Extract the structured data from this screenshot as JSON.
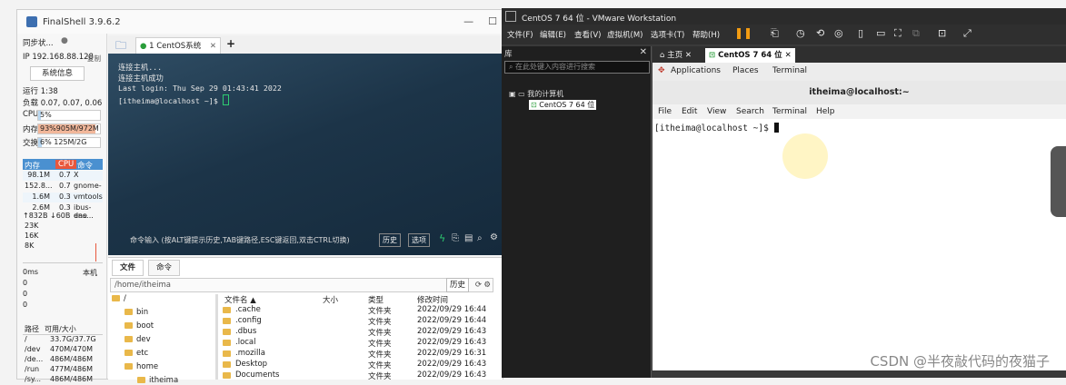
{
  "finalshell": {
    "title": "FinalShell 3.9.6.2",
    "sync_status": "同步状...",
    "ip": "IP 192.168.88.128",
    "copy_label": "复制",
    "sysinfo_btn": "系统信息",
    "uptime": "运行 1:38",
    "load": "负载 0.07, 0.07, 0.06",
    "cpu_label": "CPU",
    "cpu_value": "5%",
    "cpu_fraction": 0.05,
    "mem_label": "内存",
    "mem_value": "93%905M/972M",
    "mem_fraction": 0.93,
    "swap_label": "交换",
    "swap_value": "6%     125M/2G",
    "swap_fraction": 0.06,
    "proc_headers": [
      "内存",
      "CPU",
      "命令"
    ],
    "procs": [
      {
        "mem": "98.1M",
        "cpu": "0.7",
        "cmd": "X"
      },
      {
        "mem": "152.8...",
        "cpu": "0.7",
        "cmd": "gnome-"
      },
      {
        "mem": "1.6M",
        "cpu": "0.3",
        "cmd": "vmtools"
      },
      {
        "mem": "2.6M",
        "cpu": "0.3",
        "cmd": "ibus-dae"
      }
    ],
    "net_up": "↑832B",
    "net_down": "↓60B",
    "net_iface": "ens...",
    "net_ticks": [
      "23K",
      "16K",
      "8K"
    ],
    "ping_label": "0ms",
    "ping_host": "本机",
    "ping_ticks": [
      "0",
      "0",
      "0"
    ],
    "disk_headers": [
      "路径",
      "可用/大小"
    ],
    "disks": [
      {
        "path": "/",
        "size": "33.7G/37.7G"
      },
      {
        "path": "/dev",
        "size": "470M/470M"
      },
      {
        "path": "/de...",
        "size": "486M/486M"
      },
      {
        "path": "/run",
        "size": "477M/486M"
      },
      {
        "path": "/sy...",
        "size": "486M/486M"
      }
    ],
    "tab_label": "1 CentOS系统",
    "terminal_lines": [
      "连接主机...",
      "连接主机成功",
      "Last login: Thu Sep 29 01:43:41 2022",
      "[itheima@localhost ~]$ "
    ],
    "cmd_placeholder": "命令输入 (按ALT键提示历史,TAB键路径,ESC键返回,双击CTRL切换)",
    "history_btn": "历史",
    "options_btn": "选项",
    "lower_tabs": [
      "文件",
      "命令"
    ],
    "path": "/home/itheima",
    "path_history": "历史",
    "tree": [
      {
        "name": "/",
        "indent": 0
      },
      {
        "name": "bin",
        "indent": 1
      },
      {
        "name": "boot",
        "indent": 1
      },
      {
        "name": "dev",
        "indent": 1
      },
      {
        "name": "etc",
        "indent": 1
      },
      {
        "name": "home",
        "indent": 1
      },
      {
        "name": "itheima",
        "indent": 2
      }
    ],
    "file_headers": [
      "文件名 ▲",
      "大小",
      "类型",
      "修改时间"
    ],
    "files": [
      {
        "name": ".cache",
        "size": "",
        "type": "文件夹",
        "mtime": "2022/09/29 16:44"
      },
      {
        "name": ".config",
        "size": "",
        "type": "文件夹",
        "mtime": "2022/09/29 16:44"
      },
      {
        "name": ".dbus",
        "size": "",
        "type": "文件夹",
        "mtime": "2022/09/29 16:43"
      },
      {
        "name": ".local",
        "size": "",
        "type": "文件夹",
        "mtime": "2022/09/29 16:43"
      },
      {
        "name": ".mozilla",
        "size": "",
        "type": "文件夹",
        "mtime": "2022/09/29 16:31"
      },
      {
        "name": "Desktop",
        "size": "",
        "type": "文件夹",
        "mtime": "2022/09/29 16:43"
      },
      {
        "name": "Documents",
        "size": "",
        "type": "文件夹",
        "mtime": "2022/09/29 16:43"
      }
    ]
  },
  "vmware": {
    "title": "CentOS 7 64 位 - VMware Workstation",
    "menu": [
      "文件(F)",
      "编辑(E)",
      "查看(V)",
      "虚拟机(M)",
      "选项卡(T)",
      "帮助(H)"
    ],
    "library_label": "库",
    "search_placeholder": "在此处键入内容进行搜索",
    "my_computer": "我的计算机",
    "vm_name": "CentOS 7 64 位",
    "tabs": [
      "主页",
      "CentOS 7 64 位"
    ],
    "gnome_menu": [
      "Applications",
      "Places",
      "Terminal"
    ],
    "terminal_title": "itheima@localhost:~",
    "terminal_menu": [
      "File",
      "Edit",
      "View",
      "Search",
      "Terminal",
      "Help"
    ],
    "prompt": "[itheima@localhost ~]$ "
  },
  "watermark": "CSDN @半夜敲代码的夜猫子",
  "colors": {
    "accent": "#4a90d0",
    "mem_fill": "#f2b79a",
    "cpu_fill": "#b9d7f0"
  }
}
